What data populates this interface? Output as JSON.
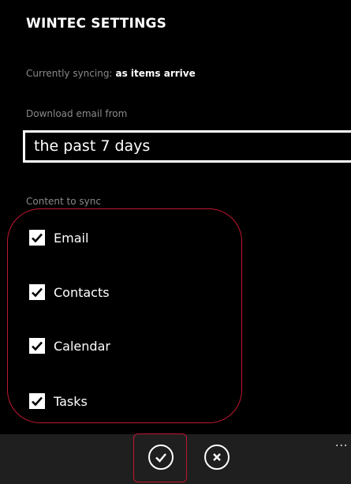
{
  "header": {
    "title": "WINTEC SETTINGS"
  },
  "sync": {
    "label": "Currently syncing:",
    "value": "as items arrive"
  },
  "download": {
    "label": "Download email from",
    "selected": "the past 7 days"
  },
  "content": {
    "label": "Content to sync",
    "items": [
      {
        "label": "Email",
        "checked": true
      },
      {
        "label": "Contacts",
        "checked": true
      },
      {
        "label": "Calendar",
        "checked": true
      },
      {
        "label": "Tasks",
        "checked": true
      }
    ]
  },
  "appbar": {
    "buttons": [
      {
        "icon": "checkmark-icon",
        "action": "save"
      },
      {
        "icon": "close-icon",
        "action": "cancel"
      }
    ],
    "more": "..."
  },
  "colors": {
    "background": "#000000",
    "appbar": "#1f1f1f",
    "label_gray": "#8a8a8a",
    "highlight": "#c01830"
  }
}
